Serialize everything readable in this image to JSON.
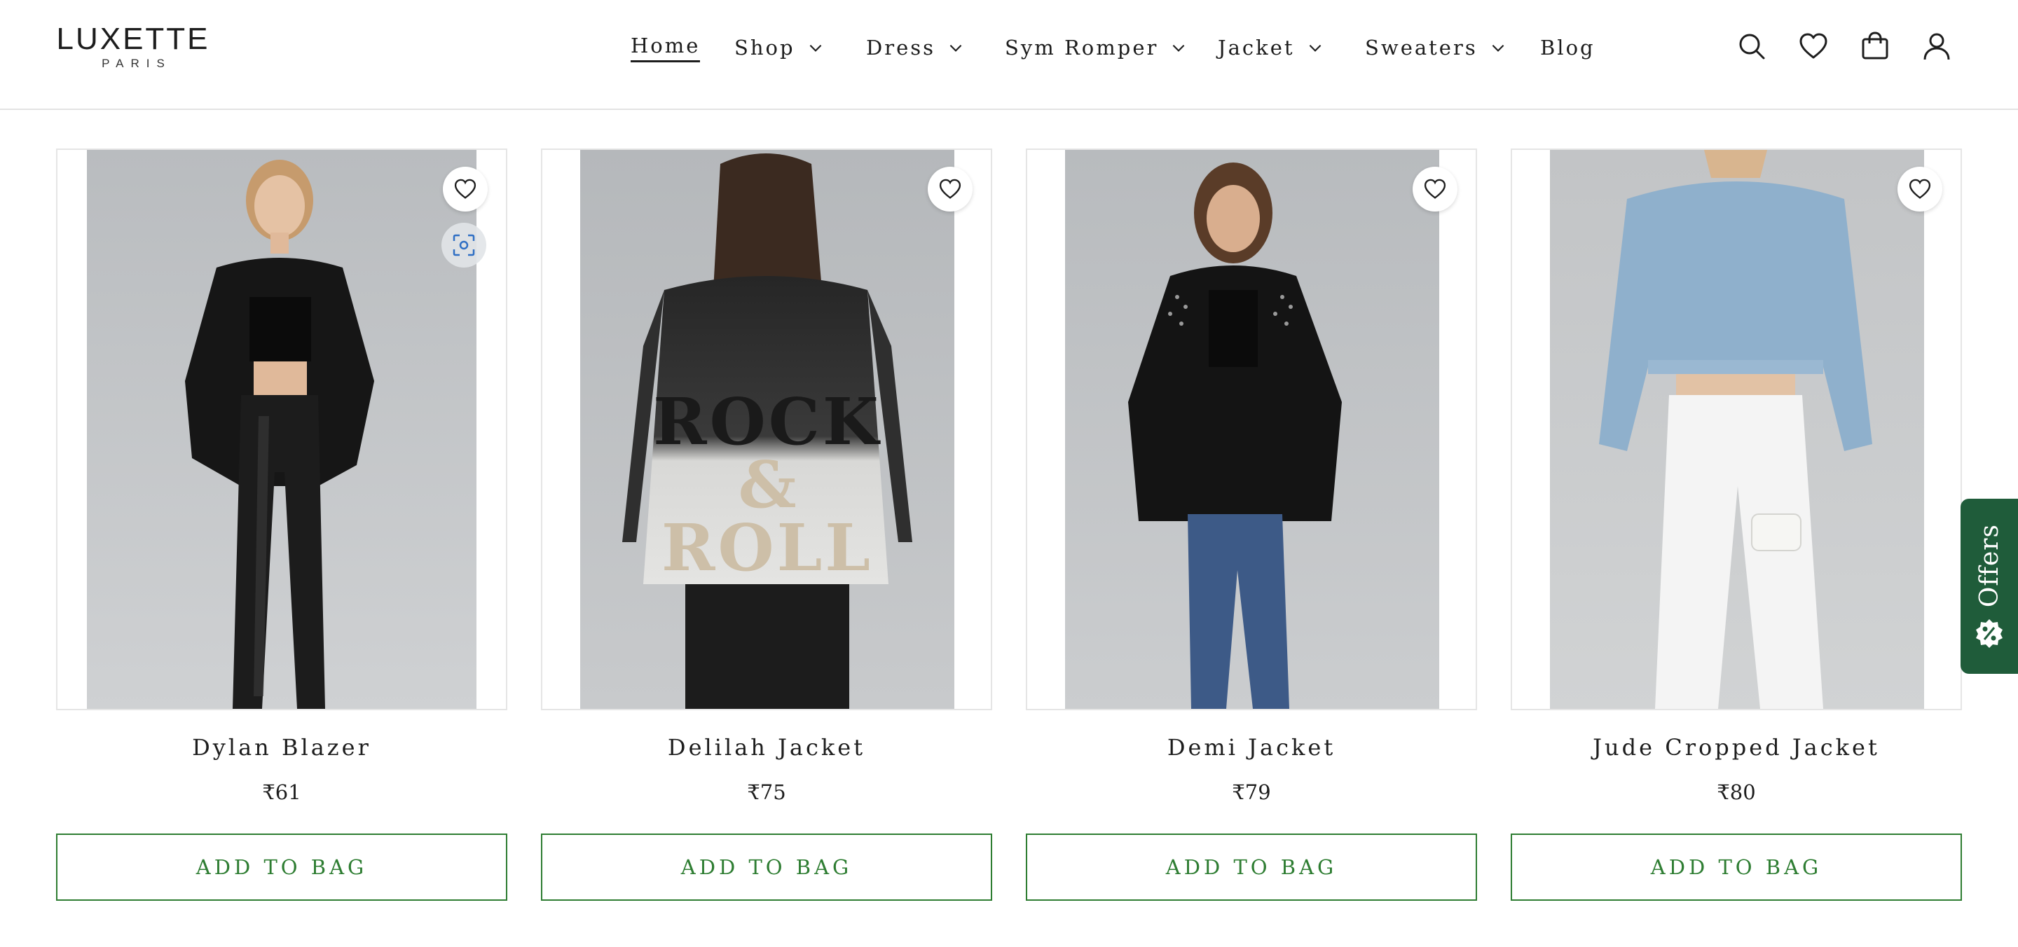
{
  "logo": {
    "brand": "LUXETTE",
    "sub": "PARIS"
  },
  "nav": {
    "home": "Home",
    "shop": "Shop",
    "dress": "Dress",
    "sym_romper": "Sym Romper",
    "jacket": "Jacket",
    "sweaters": "Sweaters",
    "blog": "Blog"
  },
  "header_icons": [
    "search-icon",
    "heart-icon",
    "bag-icon",
    "user-icon"
  ],
  "products": [
    {
      "name": "Dylan Blazer",
      "price": "₹61",
      "cta": "ADD TO BAG"
    },
    {
      "name": "Delilah Jacket",
      "price": "₹75",
      "cta": "ADD TO BAG"
    },
    {
      "name": "Demi Jacket",
      "price": "₹79",
      "cta": "ADD TO BAG"
    },
    {
      "name": "Jude Cropped Jacket",
      "price": "₹80",
      "cta": "ADD TO BAG"
    }
  ],
  "shirt_print": {
    "line1": "ROCK",
    "line2": "&",
    "line3": "ROLL"
  },
  "offers": {
    "label": "Offers"
  },
  "colors": {
    "accent_green": "#2e7d32",
    "offers_bg": "#1f5c3a",
    "text": "#1d1d1d",
    "border": "#e5e5e5"
  }
}
